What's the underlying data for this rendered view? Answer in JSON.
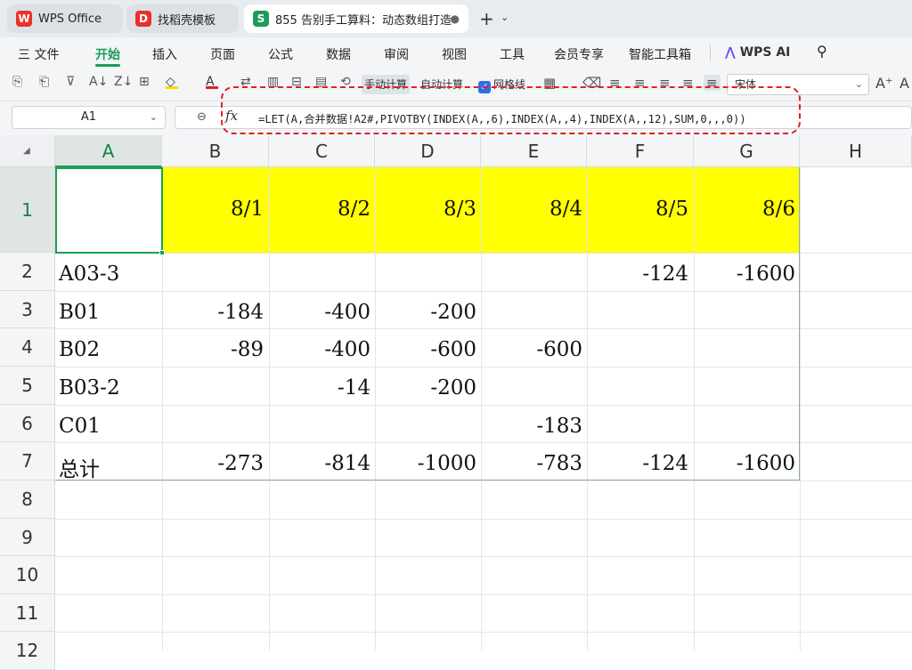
{
  "tabs": [
    {
      "label": "WPS Office",
      "icon": "wps-logo-icon"
    },
    {
      "label": "找稻壳模板",
      "icon": "docer-icon"
    },
    {
      "label": "855 告别手工算料：动态数组打造",
      "icon": "spreadsheet-icon",
      "active": true
    }
  ],
  "menu": {
    "file": "三 文件",
    "items": [
      "开始",
      "插入",
      "页面",
      "公式",
      "数据",
      "审阅",
      "视图",
      "工具",
      "会员专享",
      "智能工具箱"
    ],
    "ai": "WPS AI"
  },
  "toolbar": {
    "manual_calc": "手动计算",
    "auto_calc": "自动计算",
    "gridlines": "网格线",
    "font_name": "宋体"
  },
  "formula_bar": {
    "cell_ref": "A1",
    "fx": "fx",
    "formula": "=LET(A,合并数据!A2#,PIVOTBY(INDEX(A,,6),INDEX(A,,4),INDEX(A,,12),SUM,0,,,0))"
  },
  "sheet": {
    "columns": [
      "A",
      "B",
      "C",
      "D",
      "E",
      "F",
      "G",
      "H"
    ],
    "rows": [
      "1",
      "2",
      "3",
      "4",
      "5",
      "6",
      "7",
      "8",
      "9",
      "10",
      "11",
      "12"
    ],
    "header_dates": [
      "8/1",
      "8/2",
      "8/3",
      "8/4",
      "8/5",
      "8/6"
    ],
    "data": [
      {
        "name": "A03-3",
        "values": [
          "",
          "",
          "",
          "",
          "-124",
          "-1600"
        ]
      },
      {
        "name": "B01",
        "values": [
          "-184",
          "-400",
          "-200",
          "",
          "",
          ""
        ]
      },
      {
        "name": "B02",
        "values": [
          "-89",
          "-400",
          "-600",
          "-600",
          "",
          ""
        ]
      },
      {
        "name": "B03-2",
        "values": [
          "",
          "-14",
          "-200",
          "",
          "",
          ""
        ]
      },
      {
        "name": "C01",
        "values": [
          "",
          "",
          "",
          "-183",
          "",
          ""
        ]
      },
      {
        "name": "总计",
        "values": [
          "-273",
          "-814",
          "-1000",
          "-783",
          "-124",
          "-1600"
        ]
      }
    ],
    "header_fill": "#ffff00",
    "accent": "#1a9d57"
  }
}
